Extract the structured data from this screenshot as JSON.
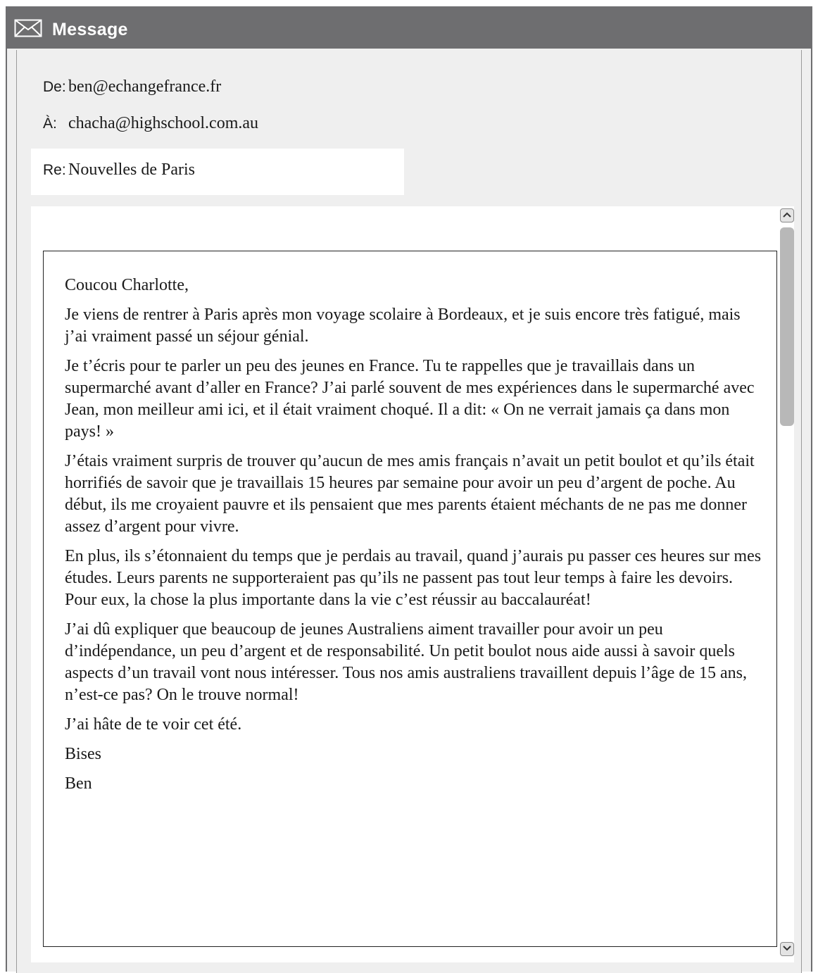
{
  "window": {
    "title": "Message",
    "icon": "envelope-icon"
  },
  "header": {
    "from_label": "De:",
    "from_value": "ben@echangefrance.fr",
    "to_label": "À:",
    "to_value": "chacha@highschool.com.au",
    "subject_label": "Re:",
    "subject_value": "Nouvelles de Paris"
  },
  "message": {
    "paragraphs": [
      "Coucou Charlotte,",
      "Je viens de rentrer à Paris après mon voyage scolaire à Bordeaux, et je suis encore très fatigué, mais j’ai vraiment passé un séjour génial.",
      "Je t’écris pour te parler un peu des jeunes en France. Tu te rappelles que je travaillais dans un supermarché avant d’aller en France? J’ai parlé souvent de mes expériences dans le supermarché avec Jean, mon meilleur ami ici, et il était vraiment choqué. Il a dit: « On ne verrait jamais ça dans mon pays! »",
      "J’étais vraiment surpris de trouver qu’aucun de mes amis français n’avait un petit boulot et qu’ils était horrifiés de savoir que je travaillais 15 heures par semaine pour avoir un peu d’argent de poche. Au début, ils me croyaient pauvre et ils pensaient que mes parents étaient méchants de ne pas me donner assez d’argent pour vivre.",
      "En plus, ils s’étonnaient du temps que je perdais au travail, quand j’aurais pu passer ces heures sur mes études. Leurs parents ne supporteraient pas qu’ils ne passent pas tout leur temps à faire les devoirs. Pour eux, la chose la plus importante dans la vie c’est réussir au baccalauréat!",
      "J’ai dû expliquer que beaucoup de jeunes Australiens aiment travailler pour avoir un peu d’indépendance, un peu d’argent et de responsabilité. Un petit boulot nous aide aussi à savoir quels aspects d’un travail vont nous intéresser. Tous nos amis australiens travaillent depuis l’âge de 15 ans, n’est-ce pas? On le trouve normal!",
      "J’ai hâte de te voir cet été.",
      "Bises",
      "Ben"
    ]
  },
  "scrollbar": {
    "up_icon": "chevron-up-icon",
    "down_icon": "chevron-down-icon",
    "position": 0
  },
  "colors": {
    "titlebar": "#6e6e70",
    "window_bg": "#efefef",
    "content_bg": "#ffffff"
  }
}
